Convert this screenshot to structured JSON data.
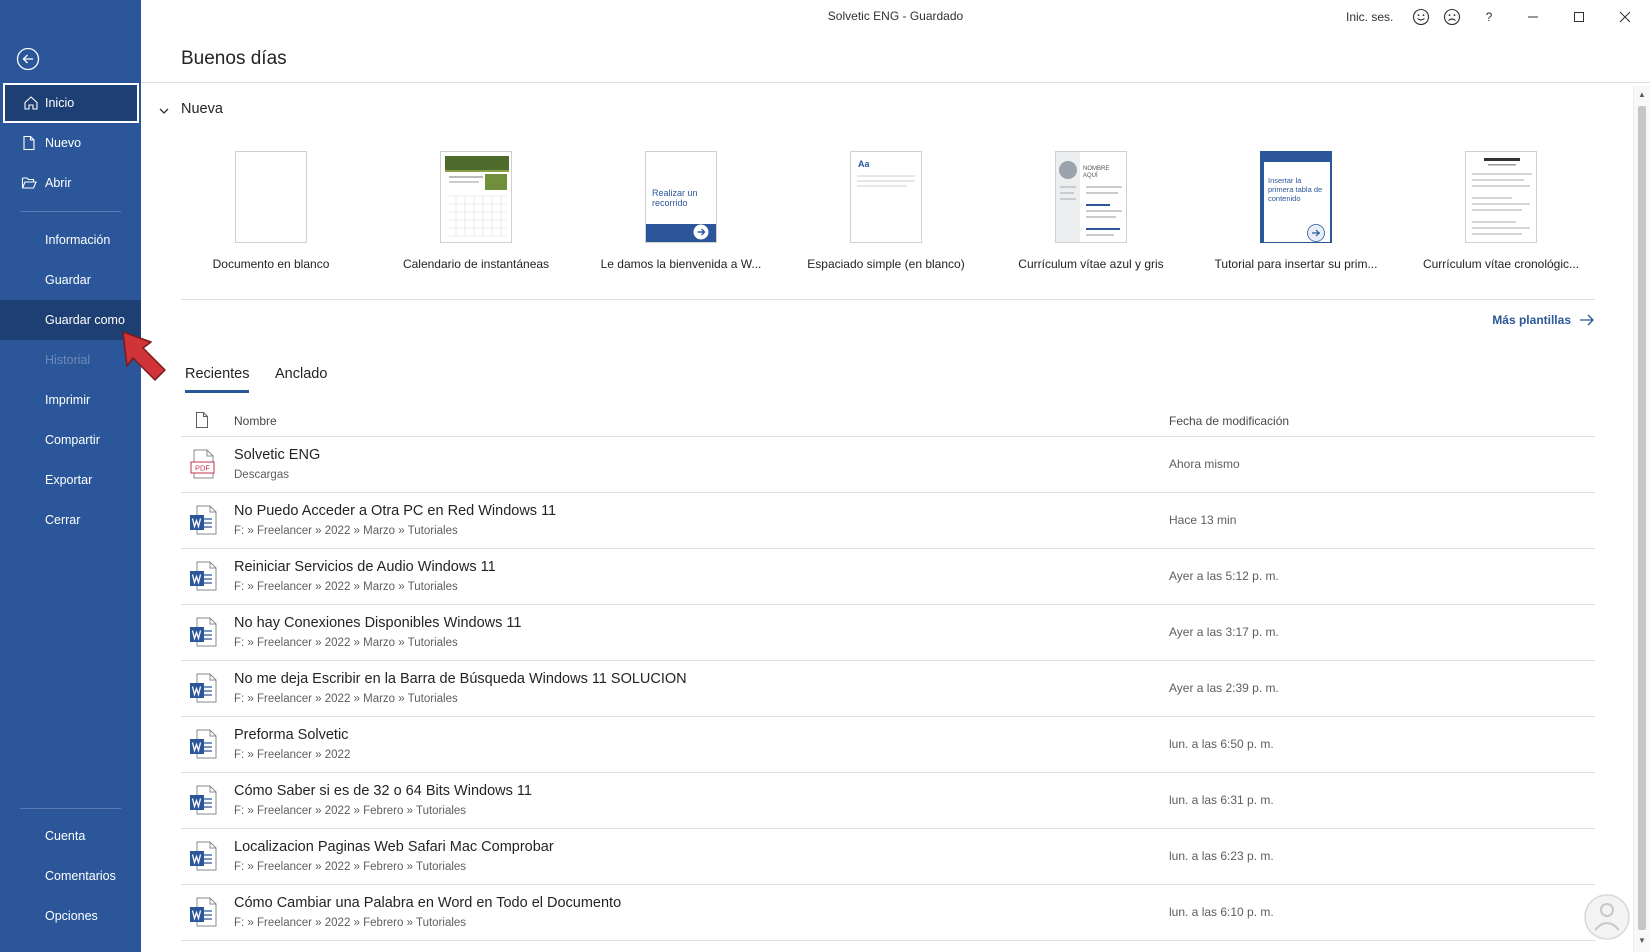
{
  "window": {
    "title": "Solvetic ENG  -  Guardado",
    "sign_in": "Inic. ses.",
    "help": "?"
  },
  "sidebar": {
    "items": [
      {
        "label": "Inicio",
        "icon": "home-icon"
      },
      {
        "label": "Nuevo",
        "icon": "new-document-icon"
      },
      {
        "label": "Abrir",
        "icon": "open-folder-icon"
      },
      {
        "label": "Información"
      },
      {
        "label": "Guardar"
      },
      {
        "label": "Guardar como"
      },
      {
        "label": "Historial"
      },
      {
        "label": "Imprimir"
      },
      {
        "label": "Compartir"
      },
      {
        "label": "Exportar"
      },
      {
        "label": "Cerrar"
      }
    ],
    "bottom_items": [
      {
        "label": "Cuenta"
      },
      {
        "label": "Comentarios"
      },
      {
        "label": "Opciones"
      }
    ]
  },
  "main": {
    "greeting": "Buenos días",
    "new_section": "Nueva",
    "templates": [
      {
        "label": "Documento en blanco"
      },
      {
        "label": "Calendario de instantáneas"
      },
      {
        "label": "Le damos la bienvenida a W...",
        "thumb_text": "Realizar un recorrido"
      },
      {
        "label": "Espaciado simple (en blanco)",
        "thumb_text": "Aa"
      },
      {
        "label": "Currículum vítae azul y gris",
        "thumb_text": "NOMBRE AQUÍ"
      },
      {
        "label": "Tutorial para insertar su prim...",
        "thumb_text": "Insertar la primera tabla de contenido"
      },
      {
        "label": "Currículum vítae cronológic..."
      }
    ],
    "more_templates": "Más plantillas",
    "tabs": [
      {
        "label": "Recientes",
        "active": true
      },
      {
        "label": "Anclado",
        "active": false
      }
    ],
    "columns": {
      "name": "Nombre",
      "modified": "Fecha de modificación"
    },
    "recent_files": [
      {
        "name": "Solvetic ENG",
        "path": "Descargas",
        "date": "Ahora mismo",
        "type": "pdf"
      },
      {
        "name": "No Puedo Acceder a Otra PC en Red Windows 11",
        "path": "F: » Freelancer » 2022 » Marzo » Tutoriales",
        "date": "Hace 13 min",
        "type": "word"
      },
      {
        "name": "Reiniciar Servicios de Audio Windows 11",
        "path": "F: » Freelancer » 2022 » Marzo » Tutoriales",
        "date": "Ayer a las 5:12 p. m.",
        "type": "word"
      },
      {
        "name": "No hay Conexiones Disponibles Windows 11",
        "path": "F: » Freelancer » 2022 » Marzo » Tutoriales",
        "date": "Ayer a las 3:17 p. m.",
        "type": "word"
      },
      {
        "name": "No me deja Escribir en la Barra de Búsqueda Windows 11  SOLUCION",
        "path": "F: » Freelancer » 2022 » Marzo » Tutoriales",
        "date": "Ayer a las 2:39 p. m.",
        "type": "word"
      },
      {
        "name": "Preforma Solvetic",
        "path": "F: » Freelancer » 2022",
        "date": "lun. a las 6:50 p. m.",
        "type": "word"
      },
      {
        "name": "Cómo Saber si es de 32 o 64 Bits Windows 11",
        "path": "F: » Freelancer » 2022 » Febrero » Tutoriales",
        "date": "lun. a las 6:31 p. m.",
        "type": "word"
      },
      {
        "name": "Localizacion Paginas Web Safari Mac  Comprobar",
        "path": "F: » Freelancer » 2022 » Febrero » Tutoriales",
        "date": "lun. a las 6:23 p. m.",
        "type": "word"
      },
      {
        "name": "Cómo Cambiar una Palabra en Word en Todo el Documento",
        "path": "F: » Freelancer » 2022 » Febrero » Tutoriales",
        "date": "lun. a las 6:10 p. m.",
        "type": "word"
      }
    ]
  },
  "colors": {
    "sidebar_bg": "#2b579a",
    "accent": "#2b579a",
    "pointer": "#d13438"
  }
}
